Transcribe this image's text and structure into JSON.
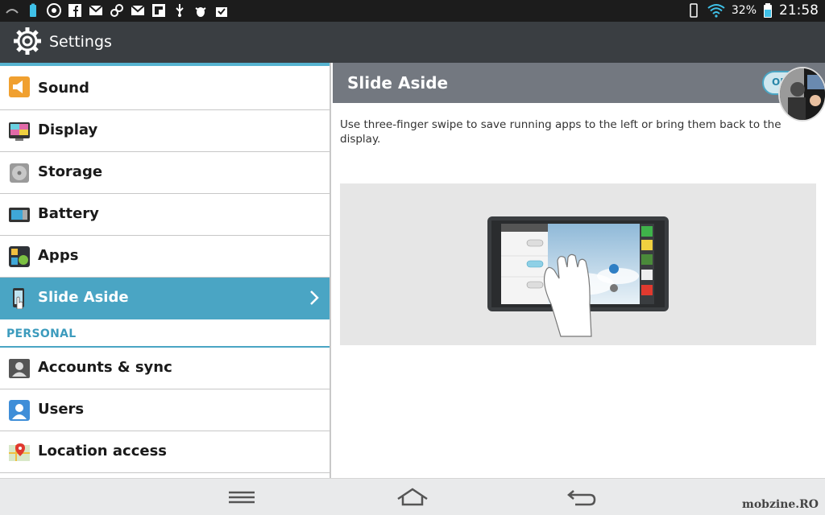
{
  "status_bar": {
    "battery_percent": "32%",
    "time": "21:58"
  },
  "action_bar": {
    "title": "Settings"
  },
  "settings_list": {
    "items": [
      {
        "label": "Sound",
        "icon": "speaker-icon"
      },
      {
        "label": "Display",
        "icon": "display-icon"
      },
      {
        "label": "Storage",
        "icon": "storage-disk-icon"
      },
      {
        "label": "Battery",
        "icon": "battery-icon"
      },
      {
        "label": "Apps",
        "icon": "apps-icon"
      },
      {
        "label": "Slide Aside",
        "icon": "slide-aside-hand-icon",
        "selected": true
      }
    ],
    "section_personal": "PERSONAL",
    "personal_items": [
      {
        "label": "Accounts & sync",
        "icon": "accounts-icon"
      },
      {
        "label": "Users",
        "icon": "users-icon"
      },
      {
        "label": "Location access",
        "icon": "location-map-icon"
      }
    ]
  },
  "detail": {
    "title": "Slide Aside",
    "toggle_label": "ON",
    "description": "Use three-finger swipe to save running apps to the left or bring them back to the display."
  },
  "watermark": "mobzine.RO",
  "colors": {
    "accent": "#4aa5c4",
    "action_bar": "#3a3e42",
    "status_bar": "#1c1c1c",
    "detail_header": "#737880"
  }
}
